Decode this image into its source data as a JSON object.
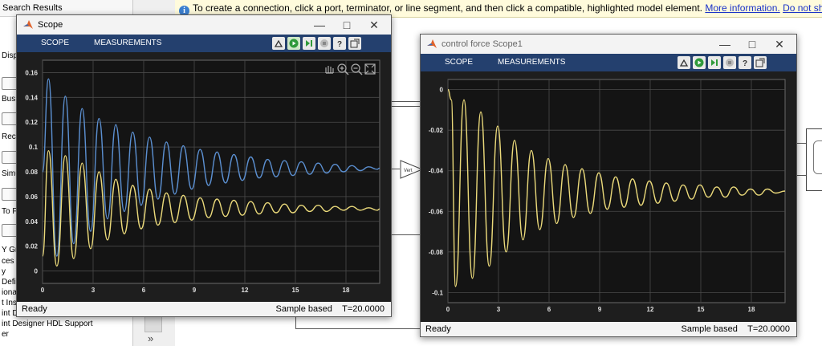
{
  "infobar": {
    "message": "To create a connection, click a port, terminator, or line segment, and then click a compatible, highlighted model element.",
    "more_link": "More information.",
    "dismiss_link": "Do not show again"
  },
  "left_panel": {
    "header": "Search Results",
    "items": [
      "Displa",
      "Bus El",
      "Recor",
      "Simu",
      "To Fil",
      "Y Gra",
      "ces",
      "y",
      "Defin",
      "ional",
      "t Inse",
      "int D",
      "int Designer HDL Support",
      "er"
    ]
  },
  "scope1": {
    "title": "Scope",
    "tabs": [
      "SCOPE",
      "MEASUREMENTS"
    ],
    "status_left": "Ready",
    "status_mode": "Sample based",
    "status_time": "T=20.0000",
    "colors": {
      "series1": "#5b8fd0",
      "series2": "#ead97a",
      "bg": "#1e1e1e",
      "grid": "#4a4a4a"
    }
  },
  "scope2": {
    "title": "control force Scope1",
    "tabs": [
      "SCOPE",
      "MEASUREMENTS"
    ],
    "status_left": "Ready",
    "status_mode": "Sample based",
    "status_time": "T=20.0000",
    "colors": {
      "series1": "#ead97a",
      "bg": "#1e1e1e",
      "grid": "#4a4a4a"
    }
  },
  "gain_block_label": "Vert",
  "chart_data": [
    {
      "type": "line",
      "title": "",
      "xlim": [
        0,
        20
      ],
      "ylim": [
        -0.01,
        0.17
      ],
      "xticks": [
        0,
        3,
        6,
        9,
        12,
        15,
        18
      ],
      "yticks": [
        0,
        0.02,
        0.04,
        0.06,
        0.08,
        0.1,
        0.12,
        0.14,
        0.16
      ],
      "yticklabels": [
        "0",
        "0.02",
        "0.04",
        "0.06",
        "0.08",
        "0.1",
        "0.12",
        "0.14",
        "0.16"
      ],
      "grid": true,
      "series": [
        {
          "x": [
            0,
            0.35,
            0.85,
            1.35,
            1.85,
            2.35,
            2.85,
            3.35,
            3.85,
            4.35,
            4.85,
            5.35,
            5.85,
            6.35,
            6.85,
            7.35,
            7.85,
            8.35,
            8.85,
            9.35,
            9.85,
            10.35,
            10.85,
            11.35,
            11.85,
            12.35,
            12.85,
            13.35,
            13.85,
            14.35,
            14.85,
            15.35,
            15.85,
            16.35,
            16.85,
            17.35,
            17.85,
            18.35,
            18.85,
            19.35,
            19.85,
            20
          ],
          "y": [
            0.08,
            0.155,
            0.012,
            0.141,
            0.022,
            0.131,
            0.032,
            0.123,
            0.042,
            0.118,
            0.048,
            0.112,
            0.053,
            0.108,
            0.058,
            0.104,
            0.062,
            0.101,
            0.066,
            0.098,
            0.069,
            0.096,
            0.071,
            0.094,
            0.073,
            0.092,
            0.075,
            0.09,
            0.076,
            0.089,
            0.077,
            0.088,
            0.078,
            0.087,
            0.079,
            0.086,
            0.08,
            0.085,
            0.081,
            0.084,
            0.082,
            0.083
          ]
        },
        {
          "x": [
            0,
            0.35,
            0.85,
            1.35,
            1.85,
            2.35,
            2.85,
            3.35,
            3.85,
            4.35,
            4.85,
            5.35,
            5.85,
            6.35,
            6.85,
            7.35,
            7.85,
            8.35,
            8.85,
            9.35,
            9.85,
            10.35,
            10.85,
            11.35,
            11.85,
            12.35,
            12.85,
            13.35,
            13.85,
            14.35,
            14.85,
            15.35,
            15.85,
            16.35,
            16.85,
            17.35,
            17.85,
            18.35,
            18.85,
            19.35,
            19.85,
            20
          ],
          "y": [
            0.012,
            0.097,
            0.004,
            0.093,
            0.01,
            0.087,
            0.018,
            0.08,
            0.025,
            0.074,
            0.03,
            0.069,
            0.034,
            0.066,
            0.037,
            0.063,
            0.039,
            0.061,
            0.041,
            0.059,
            0.043,
            0.058,
            0.044,
            0.057,
            0.045,
            0.056,
            0.046,
            0.055,
            0.047,
            0.054,
            0.047,
            0.053,
            0.048,
            0.053,
            0.048,
            0.052,
            0.049,
            0.052,
            0.049,
            0.051,
            0.049,
            0.05
          ]
        }
      ]
    },
    {
      "type": "line",
      "title": "",
      "xlim": [
        0,
        20
      ],
      "ylim": [
        -0.105,
        0.005
      ],
      "xticks": [
        0,
        3,
        6,
        9,
        12,
        15,
        18
      ],
      "yticks": [
        0,
        -0.02,
        -0.04,
        -0.06,
        -0.08,
        -0.1
      ],
      "yticklabels": [
        "0",
        "-0.02",
        "-0.04",
        "-0.06",
        "-0.08",
        "-0.1"
      ],
      "grid": true,
      "series": [
        {
          "x": [
            0,
            0.2,
            0.45,
            0.95,
            1.45,
            1.95,
            2.45,
            2.95,
            3.45,
            3.95,
            4.45,
            4.95,
            5.45,
            5.95,
            6.45,
            6.95,
            7.45,
            7.95,
            8.45,
            8.95,
            9.45,
            9.95,
            10.45,
            10.95,
            11.45,
            11.95,
            12.45,
            12.95,
            13.45,
            13.95,
            14.45,
            14.95,
            15.45,
            15.95,
            16.45,
            16.95,
            17.45,
            17.95,
            18.45,
            18.95,
            19.45,
            20
          ],
          "y": [
            0,
            -0.005,
            -0.097,
            -0.005,
            -0.093,
            -0.011,
            -0.087,
            -0.018,
            -0.08,
            -0.025,
            -0.074,
            -0.03,
            -0.069,
            -0.034,
            -0.066,
            -0.037,
            -0.063,
            -0.039,
            -0.061,
            -0.041,
            -0.059,
            -0.043,
            -0.058,
            -0.044,
            -0.057,
            -0.045,
            -0.056,
            -0.046,
            -0.055,
            -0.047,
            -0.054,
            -0.047,
            -0.053,
            -0.048,
            -0.053,
            -0.048,
            -0.052,
            -0.049,
            -0.052,
            -0.049,
            -0.051,
            -0.05
          ]
        }
      ]
    }
  ]
}
